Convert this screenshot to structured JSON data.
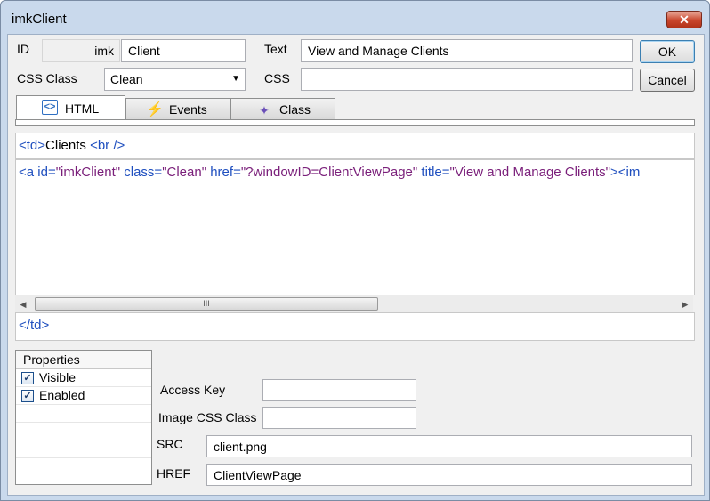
{
  "window": {
    "title": "imkClient",
    "close_glyph": "✕"
  },
  "form": {
    "id_label": "ID",
    "id_prefix": "imk",
    "id_value": "Client",
    "text_label": "Text",
    "text_value": "View and Manage Clients",
    "css_class_label": "CSS Class",
    "css_class_value": "Clean",
    "css_label": "CSS",
    "css_value": ""
  },
  "buttons": {
    "ok": "OK",
    "cancel": "Cancel"
  },
  "tabs": [
    {
      "label": "HTML",
      "icon": "html-tag-icon",
      "active": true
    },
    {
      "label": "Events",
      "icon": "lightning-icon",
      "active": false
    },
    {
      "label": "Class",
      "icon": "class-icon",
      "active": false
    }
  ],
  "code": {
    "open_tag_line": [
      "<",
      "td",
      ">",
      "Clients ",
      "<",
      "br",
      " />"
    ],
    "anchor_line": {
      "lt": "<",
      "tag": "a",
      "attr1": "id",
      "val1": "\"imkClient\"",
      "attr2": "class",
      "val2": "\"Clean\"",
      "attr3": "href",
      "val3": "\"?windowID=ClientViewPage\"",
      "attr4": "title",
      "val4": "\"View and Manage Clients\"",
      "tail": "><im"
    },
    "close_tag_line": [
      "</",
      "td",
      ">"
    ]
  },
  "scrollbar": {
    "left_arrow": "◀",
    "right_arrow": "▶",
    "grip": "III"
  },
  "properties": {
    "header": "Properties",
    "items": [
      {
        "label": "Visible",
        "checked": true
      },
      {
        "label": "Enabled",
        "checked": true
      }
    ]
  },
  "fields": {
    "access_key_label": "Access Key",
    "access_key_value": "",
    "image_css_label": "Image CSS Class",
    "image_css_value": "",
    "src_label": "SRC",
    "src_value": "client.png",
    "href_label": "HREF",
    "href_value": "ClientViewPage"
  }
}
